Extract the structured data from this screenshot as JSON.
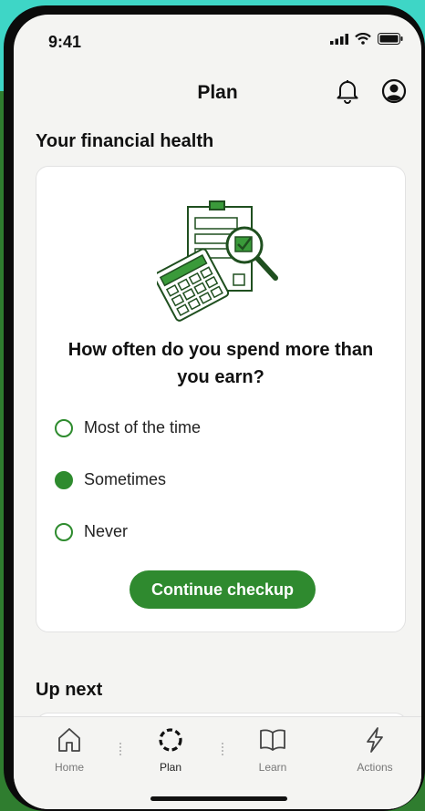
{
  "status": {
    "time": "9:41"
  },
  "header": {
    "title": "Plan"
  },
  "section_title": "Your financial health",
  "card": {
    "question": "How often do you spend more than you earn?",
    "options": [
      {
        "label": "Most of the time",
        "selected": false
      },
      {
        "label": "Sometimes",
        "selected": true
      },
      {
        "label": "Never",
        "selected": false
      }
    ],
    "button_label": "Continue checkup"
  },
  "up_next_title": "Up next",
  "tabs": [
    {
      "label": "Home",
      "icon": "home-icon",
      "active": false
    },
    {
      "label": "Plan",
      "icon": "plan-icon",
      "active": true
    },
    {
      "label": "Learn",
      "icon": "book-icon",
      "active": false
    },
    {
      "label": "Actions",
      "icon": "lightning-icon",
      "active": false
    }
  ],
  "colors": {
    "accent": "#2f8a2f",
    "teal_bg": "#3ed6c6",
    "green_bg": "#2f7d2f"
  }
}
